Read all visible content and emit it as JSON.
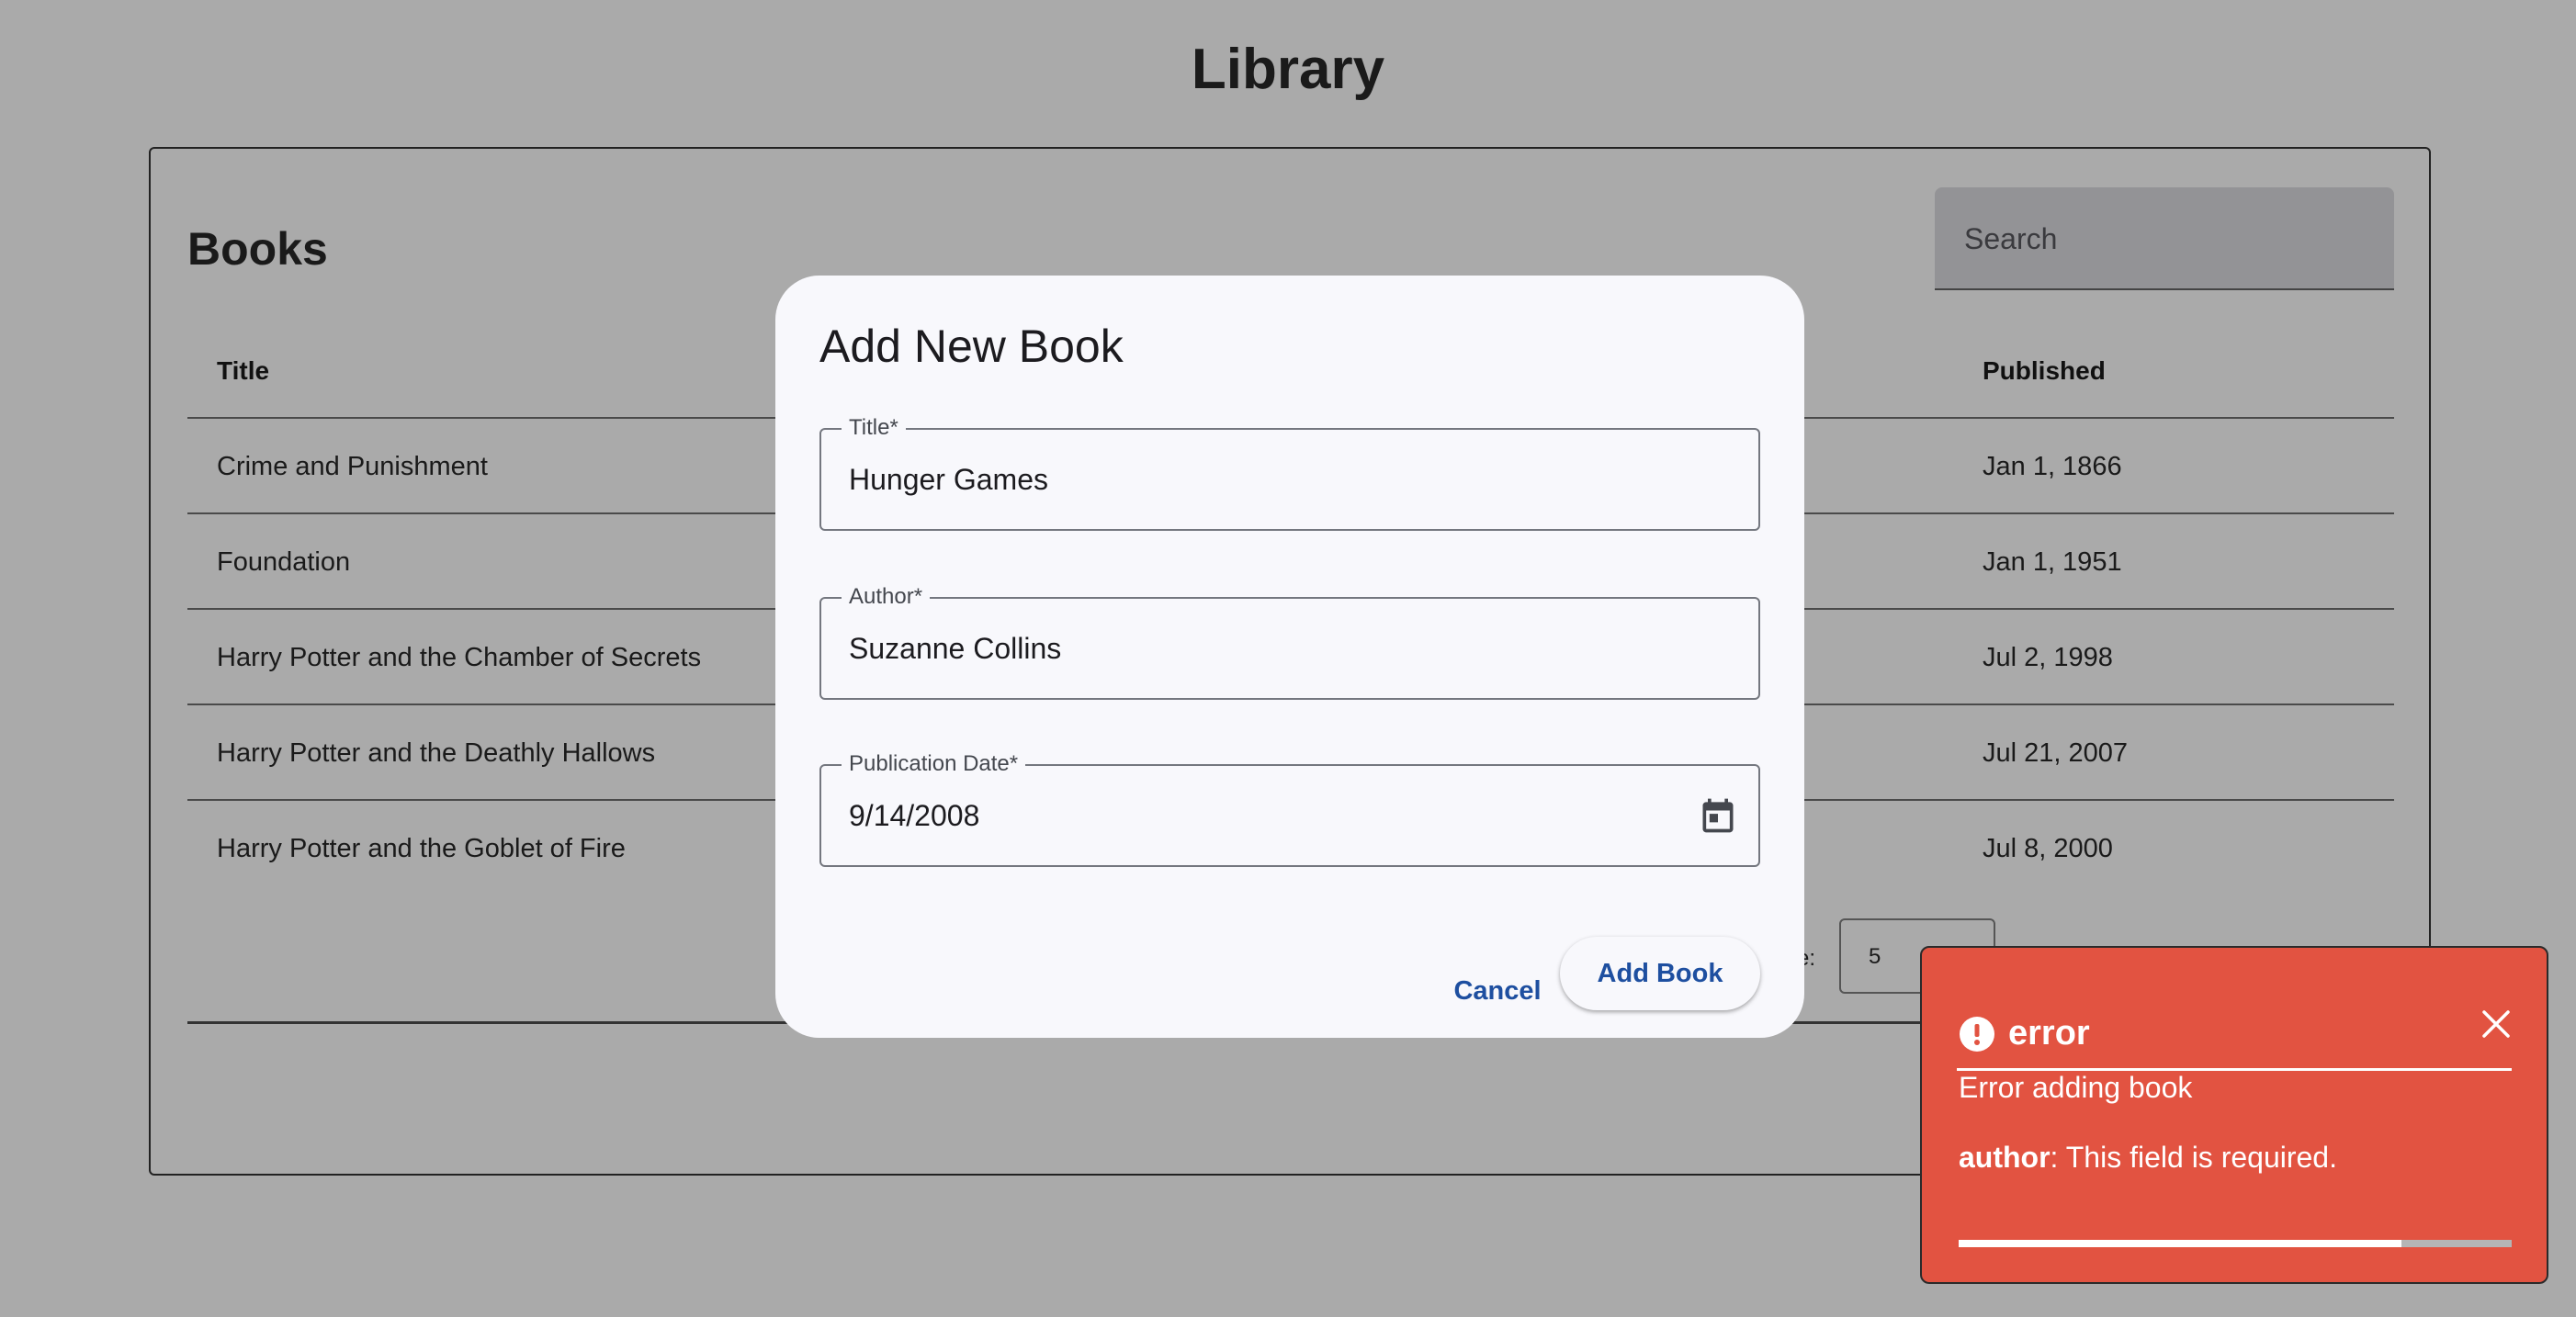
{
  "page": {
    "title": "Library"
  },
  "books_card": {
    "title": "Books",
    "search_placeholder": "Search",
    "columns": {
      "title": "Title",
      "published": "Published"
    },
    "rows": [
      {
        "title": "Crime and Punishment",
        "published": "Jan 1, 1866"
      },
      {
        "title": "Foundation",
        "published": "Jan 1, 1951"
      },
      {
        "title": "Harry Potter and the Chamber of Secrets",
        "published": "Jul 2, 1998"
      },
      {
        "title": "Harry Potter and the Deathly Hallows",
        "published": "Jul 21, 2007"
      },
      {
        "title": "Harry Potter and the Goblet of Fire",
        "published": "Jul 8, 2000"
      }
    ],
    "pagination": {
      "rows_label_fragment": "e:",
      "rows_per_page": "5"
    }
  },
  "dialog": {
    "title": "Add New Book",
    "fields": {
      "title": {
        "label": "Title*",
        "value": "Hunger Games"
      },
      "author": {
        "label": "Author*",
        "value": "Suzanne Collins"
      },
      "publication_date": {
        "label": "Publication Date*",
        "value": "9/14/2008",
        "icon": "calendar-icon"
      }
    },
    "cancel_label": "Cancel",
    "submit_label": "Add Book"
  },
  "toast": {
    "title": "error",
    "icon": "alert-circle-icon",
    "message": "Error adding book",
    "detail_field": "author",
    "detail_text": ": This field is required.",
    "progress_fraction": 0.8,
    "background_color": "#e25341"
  }
}
